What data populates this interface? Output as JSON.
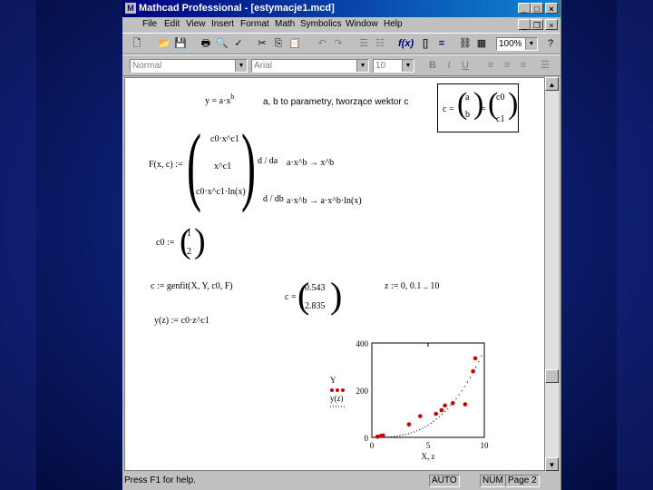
{
  "window": {
    "title": "Mathcad Professional - [estymacje1.mcd]"
  },
  "menu": [
    "File",
    "Edit",
    "View",
    "Insert",
    "Format",
    "Math",
    "Symbolics",
    "Window",
    "Help"
  ],
  "toolbar": {
    "zoom": "100%"
  },
  "format_bar": {
    "style": "Normal",
    "font": "Arial",
    "size": "10"
  },
  "worksheet": {
    "model_lhs": "y = a·x",
    "model_exp": "b",
    "model_note": "a, b to parametry, tworzące wektor c",
    "c_vec_lhs": "c =",
    "c_vec_entries": [
      "a",
      "b"
    ],
    "c_vec_eq": "=",
    "c_vec_rhs": [
      "c0",
      "c1"
    ],
    "F_lhs": "F(x, c) :=",
    "F_row1": "c0·x^c1",
    "F_row2": "x^c1",
    "F_row3": "c0·x^c1·ln(x)",
    "deriv_a_op": "d / da",
    "deriv_a_expr": "a·x^b → x^b",
    "deriv_b_op": "d / db",
    "deriv_b_expr": "a·x^b → a·x^b·ln(x)",
    "c0_lhs": "c0 :=",
    "c0_vals": [
      "1",
      "2"
    ],
    "genfit_line": "c := genfit(X, Y, c0, F)",
    "c_result_lhs": "c =",
    "c_result_vals": [
      "0.543",
      "2.835"
    ],
    "range_def": "z := 0, 0.1 .. 10",
    "yfit_def": "y(z) := c0·z^c1"
  },
  "chart_data": {
    "type": "scatter",
    "ylabel_series": [
      "Y",
      "y(z)"
    ],
    "xlabel": "X, z",
    "xlim": [
      0,
      10
    ],
    "ylim": [
      0,
      400
    ],
    "xticks": [
      "0",
      "5",
      "10"
    ],
    "yticks": [
      "0",
      "200",
      "400"
    ],
    "series": [
      {
        "name": "Y",
        "style": "points",
        "color": "#cc0000",
        "x": [
          0.5,
          0.8,
          1.0,
          3.3,
          4.3,
          5.7,
          6.2,
          6.5,
          7.2,
          8.3,
          9.0,
          9.2
        ],
        "y": [
          3,
          6,
          8,
          55,
          90,
          100,
          115,
          135,
          145,
          140,
          280,
          335
        ]
      },
      {
        "name": "y(z)",
        "style": "dotted",
        "color": "#000000",
        "model": {
          "a": 0.543,
          "b": 2.835
        }
      }
    ]
  },
  "status": {
    "help": "Press F1 for help.",
    "auto": "AUTO",
    "num": "NUM",
    "page": "Page 2"
  }
}
